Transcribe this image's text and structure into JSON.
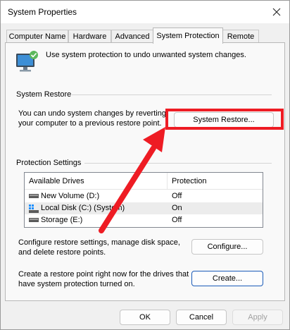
{
  "window": {
    "title": "System Properties"
  },
  "tabs": [
    {
      "label": "Computer Name"
    },
    {
      "label": "Hardware"
    },
    {
      "label": "Advanced"
    },
    {
      "label": "System Protection"
    },
    {
      "label": "Remote"
    }
  ],
  "intro": {
    "text": "Use system protection to undo unwanted system changes."
  },
  "system_restore": {
    "heading": "System Restore",
    "line1": "You can undo system changes by reverting",
    "line2": "your computer to a previous restore point.",
    "button": "System Restore..."
  },
  "protection": {
    "heading": "Protection Settings",
    "columns": [
      "Available Drives",
      "Protection"
    ],
    "drives": [
      {
        "name": "New Volume (D:)",
        "protection": "Off"
      },
      {
        "name": "Local Disk (C:) (System)",
        "protection": "On"
      },
      {
        "name": "Storage (E:)",
        "protection": "Off"
      }
    ],
    "configure_line1": "Configure restore settings, manage disk space,",
    "configure_line2": "and delete restore points.",
    "configure_button": "Configure...",
    "create_line1": "Create a restore point right now for the drives that",
    "create_line2": "have system protection turned on.",
    "create_button": "Create..."
  },
  "dialog_buttons": {
    "ok": "OK",
    "cancel": "Cancel",
    "apply": "Apply"
  },
  "colors": {
    "annotation": "#ee1c24",
    "accent": "#1a5bb8"
  }
}
